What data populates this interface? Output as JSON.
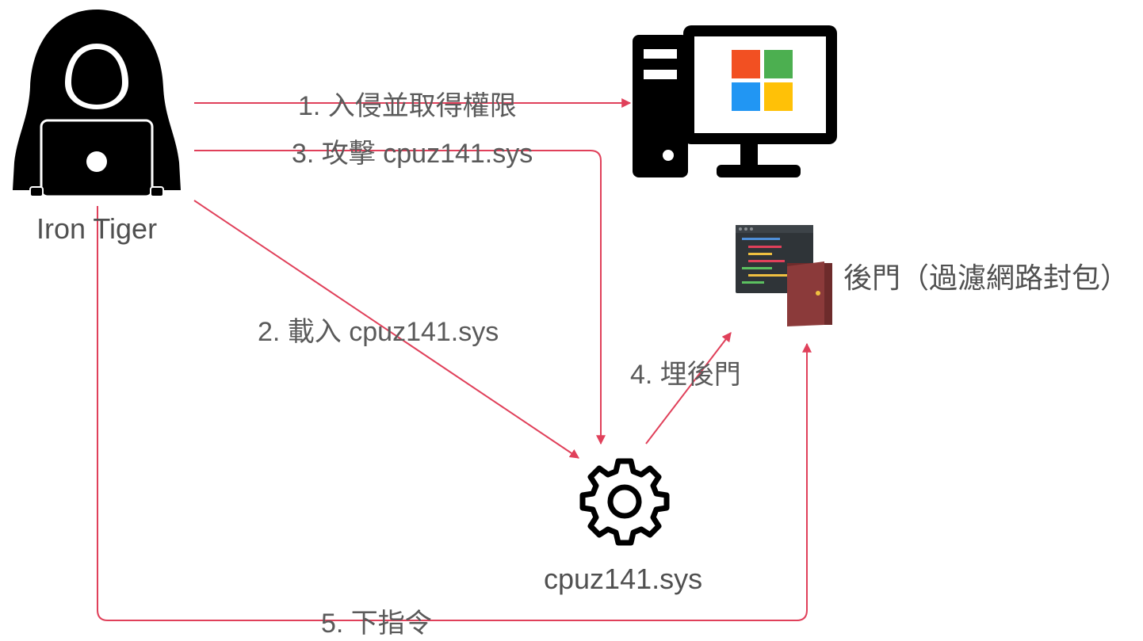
{
  "nodes": {
    "attacker": {
      "label": "Iron Tiger"
    },
    "driver": {
      "label": "cpuz141.sys"
    },
    "backdoor": {
      "label": "後門（過濾網路封包）"
    }
  },
  "edges": {
    "step1": {
      "label": "1. 入侵並取得權限"
    },
    "step2": {
      "label": "2. 載入 cpuz141.sys"
    },
    "step3": {
      "label": "3. 攻擊 cpuz141.sys"
    },
    "step4": {
      "label": "4. 埋後門"
    },
    "step5": {
      "label": "5. 下指令"
    }
  },
  "colors": {
    "edge": "#e0405a",
    "windows_red": "#f25022",
    "windows_green": "#4caf50",
    "windows_blue": "#2196f3",
    "windows_yellow": "#ffc107",
    "door": "#8b3a3a"
  },
  "icons": {
    "attacker": "hooded-hacker-icon",
    "computer": "desktop-computer-icon",
    "driver": "gear-icon",
    "backdoor": "code-door-icon"
  }
}
